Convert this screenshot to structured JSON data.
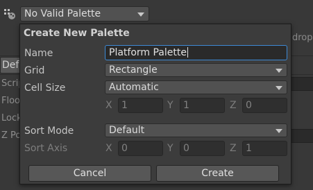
{
  "toolbar": {
    "palette_selected": "No Valid Palette"
  },
  "background": {
    "hint_text": "drop",
    "strip_defaults": "Defa",
    "strip_script": "Scrip",
    "strip_floor": "Floo",
    "strip_lock": "Lock",
    "strip_zpos": "Z Po"
  },
  "dialog": {
    "title": "Create New Palette",
    "name_label": "Name",
    "name_value": "Platform Palette",
    "grid_label": "Grid",
    "grid_value": "Rectangle",
    "cell_size_label": "Cell Size",
    "cell_size_value": "Automatic",
    "cell_size_vec": {
      "x_label": "X",
      "x": "1",
      "y_label": "Y",
      "y": "1",
      "z_label": "Z",
      "z": "0"
    },
    "sort_mode_label": "Sort Mode",
    "sort_mode_value": "Default",
    "sort_axis_label": "Sort Axis",
    "sort_axis_vec": {
      "x_label": "X",
      "x": "0",
      "y_label": "Y",
      "y": "0",
      "z_label": "Z",
      "z": "1"
    },
    "cancel_label": "Cancel",
    "create_label": "Create"
  }
}
